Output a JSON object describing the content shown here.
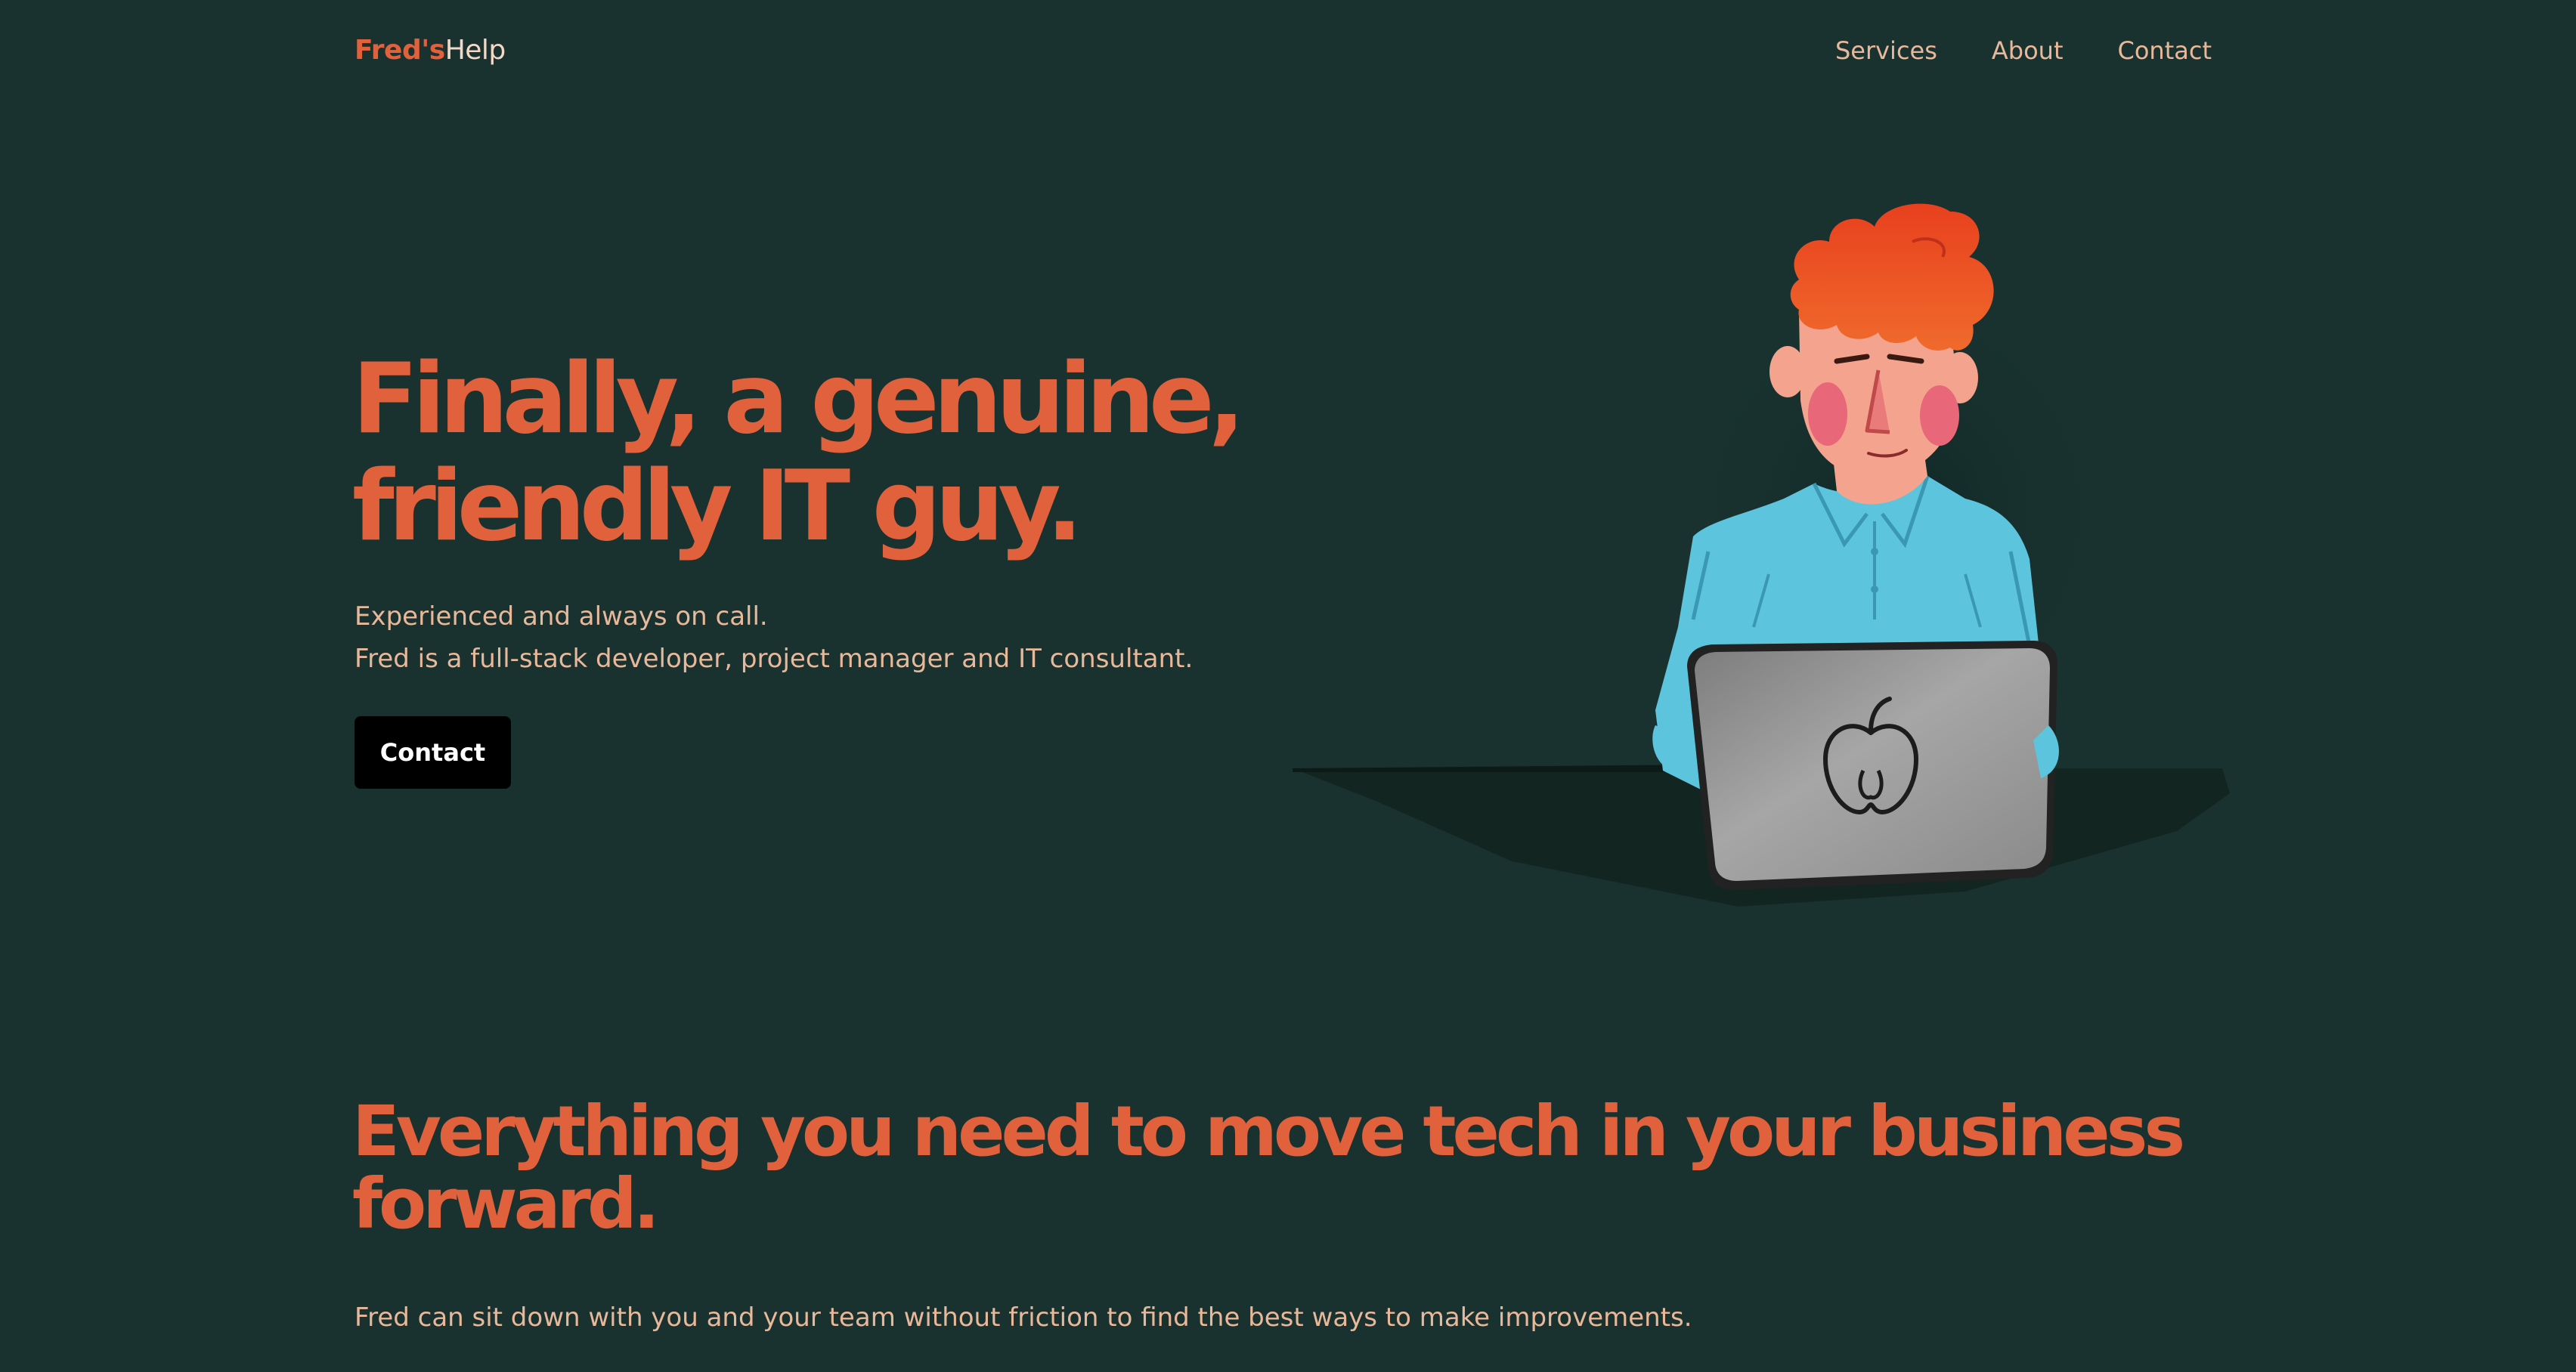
{
  "nav": {
    "logo_accent": "Fred's",
    "logo_rest": "Help",
    "links": [
      {
        "label": "Services"
      },
      {
        "label": "About"
      },
      {
        "label": "Contact"
      }
    ]
  },
  "hero": {
    "title_line1": "Finally, a genuine,",
    "title_line2": "friendly IT guy.",
    "subtitle_line1": "Experienced and always on call.",
    "subtitle_line2": "Fred is a full-stack developer, project manager and IT consultant.",
    "cta_label": "Contact"
  },
  "illustration": {
    "icon": "developer-with-laptop-illustration",
    "laptop_logo_icon": "apple-icon"
  },
  "features": {
    "title_line1": "Everything you need to move tech in your business",
    "title_line2": "forward.",
    "text": "Fred can sit down with you and your team without friction to find the best ways to make improvements."
  },
  "colors": {
    "background": "#193230",
    "accent": "#e0613c",
    "text": "#e8b89a",
    "button": "#000000",
    "shirt": "#5cc4dc",
    "hair": "#ec4f25",
    "laptop": "#9a9a9a"
  }
}
